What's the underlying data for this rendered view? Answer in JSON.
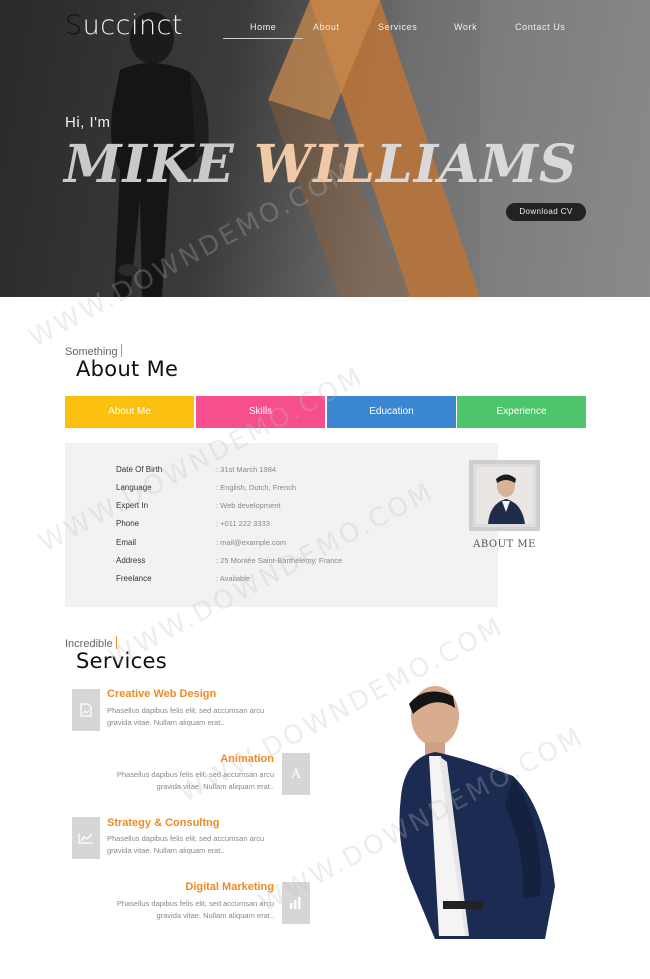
{
  "brand": {
    "first_letter": "S",
    "rest": "uccinct"
  },
  "nav": {
    "items": [
      {
        "label": "Home",
        "active": true
      },
      {
        "label": "About",
        "active": false
      },
      {
        "label": "Services",
        "active": false
      },
      {
        "label": "Work",
        "active": false
      },
      {
        "label": "Contact Us",
        "active": false
      }
    ]
  },
  "hero": {
    "greeting": "Hi, I'm",
    "name_part1": "MIKE ",
    "name_part2": "WIL",
    "name_part3": "LIAMS",
    "cv_button": "Download CV"
  },
  "about": {
    "kicker": "Something",
    "title": "About Me",
    "tabs": [
      {
        "label": "About Me",
        "color": "#fcc010"
      },
      {
        "label": "Skills",
        "color": "#f74e8e"
      },
      {
        "label": "Education",
        "color": "#3b86d1"
      },
      {
        "label": "Experience",
        "color": "#4ec46c"
      }
    ],
    "info": [
      {
        "label": "Date Of Birth",
        "value": ": 31st March 1984"
      },
      {
        "label": "Language",
        "value": ": English, Dutch, French"
      },
      {
        "label": "Expert In",
        "value": ": Web development"
      },
      {
        "label": "Phone",
        "value": ": +011 222 3333"
      },
      {
        "label": "Email",
        "value": ": mail@example.com"
      },
      {
        "label": "Address",
        "value": ": 25 Montée Saint-Barthélemy, France"
      },
      {
        "label": "Freelance",
        "value": ": Available"
      }
    ],
    "photo_caption": "ABOUT ME"
  },
  "services": {
    "kicker": "Incredible",
    "title": "Services",
    "items": [
      {
        "title": "Creative Web Design",
        "desc1": "Phasellus dapibus felis elit, sed accumsan arcu",
        "desc2": "gravida vitae. Nullam aliquam erat..",
        "icon": "image-icon",
        "align": "left"
      },
      {
        "title": "Animation",
        "desc1": "Phasellus dapibus felis elit, sed accumsan arcu",
        "desc2": "gravida vitae. Nullam aliquam erat..",
        "icon": "letter-a-icon",
        "align": "right"
      },
      {
        "title": "Strategy & Consultng",
        "desc1": "Phasellus dapibus felis elit, sed accumsan arcu",
        "desc2": "gravida vitae. Nullam aliquam erat..",
        "icon": "line-chart-icon",
        "align": "left"
      },
      {
        "title": "Digital Marketing",
        "desc1": "Phasellus dapibus felis elit, sed accumsan arcu",
        "desc2": "gravida vitae. Nullam aliquam erat..",
        "icon": "bar-chart-icon",
        "align": "right"
      }
    ]
  },
  "watermark": "WWW.DOWNDEMO.COM",
  "colors": {
    "accent": "#f08a24",
    "hero_stripe": "#b8733a"
  }
}
